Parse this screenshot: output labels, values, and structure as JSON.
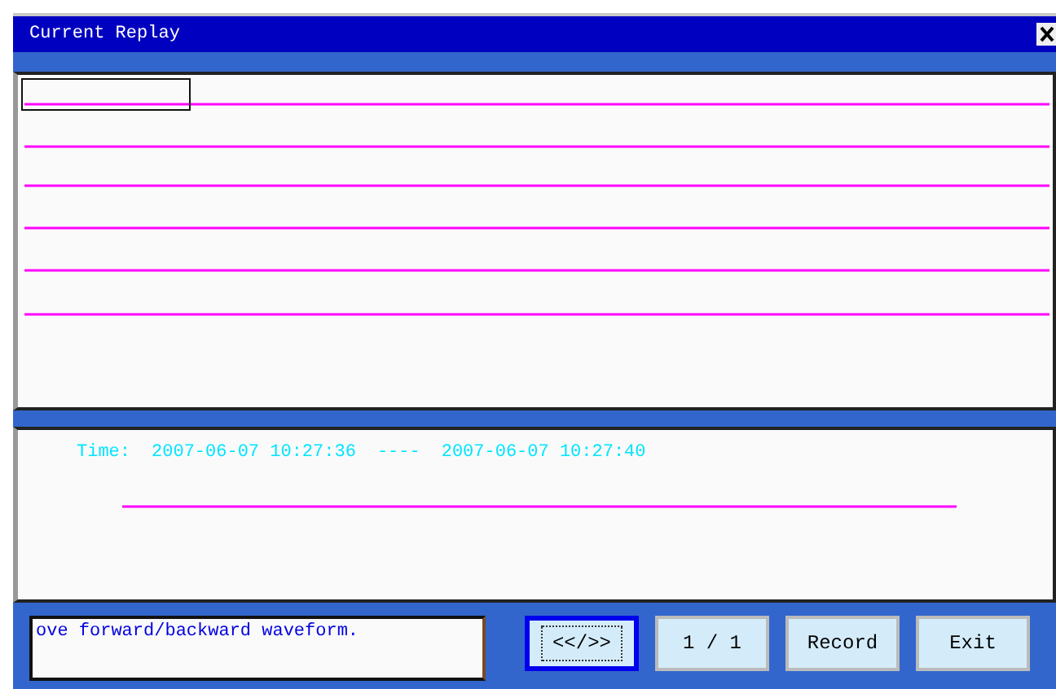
{
  "window": {
    "title": "Current Replay"
  },
  "lower_panel": {
    "time_label": "Time:",
    "start_time": "2007-06-07 10:27:36",
    "separator": "----",
    "end_time": "2007-06-07 10:27:40"
  },
  "status_message": "ove forward/backward  waveform.",
  "buttons": [
    {
      "label": "<</>>",
      "selected": true
    },
    {
      "label": "1 / 1",
      "selected": false
    },
    {
      "label": "Record",
      "selected": false
    },
    {
      "label": "Exit",
      "selected": false
    }
  ]
}
